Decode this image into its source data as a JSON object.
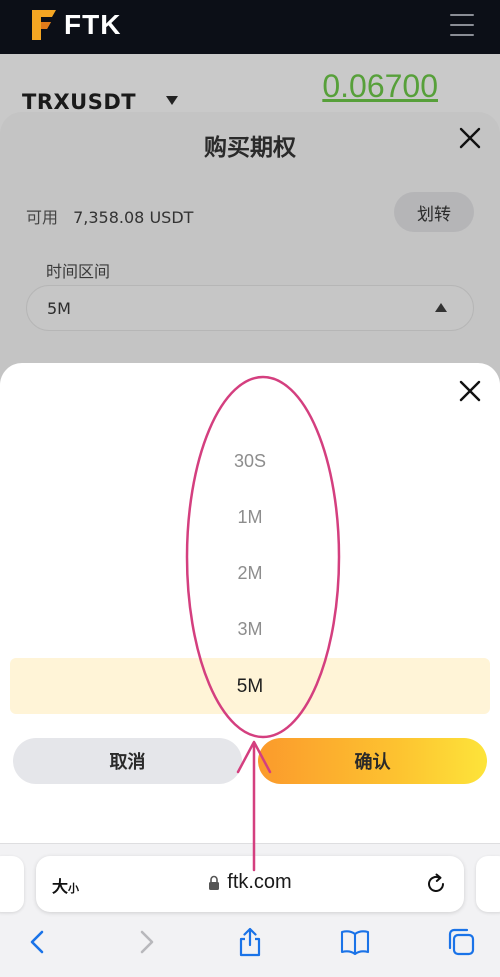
{
  "header": {
    "logo_text": "FTK"
  },
  "market": {
    "symbol": "TRXUSDT",
    "price": "0.06700",
    "price_color": "#57a03a"
  },
  "purchase_sheet": {
    "title": "购买期权",
    "available_label": "可用",
    "available_value": "7,358.08 USDT",
    "transfer_label": "划转",
    "interval_label": "时间区间",
    "interval_value": "5M"
  },
  "picker": {
    "options": [
      "30S",
      "1M",
      "2M",
      "3M",
      "5M"
    ],
    "selected": "5M",
    "cancel_label": "取消",
    "confirm_label": "确认",
    "highlight_color": "#fff4d7",
    "annotation_color": "#d43f7f"
  },
  "browser": {
    "text_size_label": "大",
    "text_size_small": "小",
    "url": "ftk.com"
  }
}
